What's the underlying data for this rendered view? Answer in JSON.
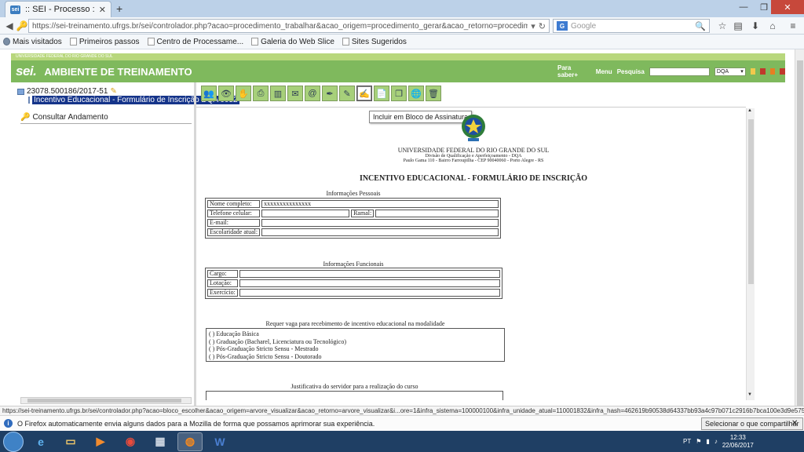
{
  "browser": {
    "tab_title": ":: SEI - Processo ::",
    "favicon_text": "sei",
    "new_tab": "+",
    "url": "https://sei-treinamento.ufrgs.br/sei/controlador.php?acao=procedimento_trabalhar&acao_origem=procedimento_gerar&acao_retorno=procedimento_escolher_tipo&id_procedimen",
    "search_placeholder": "Google",
    "search_engine": "G"
  },
  "bookmarks": [
    "Mais visitados",
    "Primeiros passos",
    "Centro de Processame...",
    "Galeria do Web Slice",
    "Sites Sugeridos"
  ],
  "sei": {
    "university": "UNIVERSIDADE FEDERAL DO RIO GRANDE DO SUL",
    "logo": "sei.",
    "environment": "AMBIENTE DE TREINAMENTO",
    "links": [
      "Para saber+",
      "Menu",
      "Pesquisa"
    ],
    "unit": "DQA",
    "header_color": "#7fb95d"
  },
  "tree": {
    "process": "23078.500186/2017-51",
    "document": "Incentivo Educacional - Formulário de Inscrição DQA 0052",
    "consult": "Consultar Andamento"
  },
  "toolbar": {
    "tooltip": "Incluir em Bloco de Assinatura",
    "icons": [
      "people-icon",
      "eye-icon",
      "hand-icon",
      "printer-icon",
      "books-icon",
      "scroll-icon",
      "mail-icon",
      "pen-icon",
      "edit-icon",
      "signature-icon",
      "new-doc-icon",
      "copy-icon",
      "globe-icon",
      "trash-icon"
    ],
    "active_index": 10
  },
  "document": {
    "institution": "UNIVERSIDADE FEDERAL DO RIO GRANDE DO SUL",
    "division": "Divisão de Qualificação e Aperfeiçoamento - DQA",
    "address": "Paulo Gama 110 - Bairro Farroupilha - CEP 90040060 - Porto Alegre - RS",
    "title": "INCENTIVO EDUCACIONAL - FORMULÁRIO DE INSCRIÇÃO",
    "personal": {
      "heading": "Informações Pessoais",
      "nome_label": "Nome completo:",
      "nome_value": "xxxxxxxxxxxxxxx",
      "telefone_label": "Telefone celular:",
      "ramal_label": "Ramal:",
      "email_label": "E-mail:",
      "escolaridade_label": "Escolaridade atual:"
    },
    "functional": {
      "heading": "Informações Funcionais",
      "cargo_label": "Cargo:",
      "lotacao_label": "Lotação:",
      "exercicio_label": "Exercício:"
    },
    "modalidade": {
      "heading": "Requer vaga para recebimento de incentivo educacional na modalidade",
      "options": [
        "(   ) Educação Básica",
        "(   ) Graduação (Bacharel, Licenciatura ou Tecnológico)",
        "(   ) Pós-Graduação Stricto Sensu - Mestrado",
        "(   ) Pós-Graduação Stricto Sensu - Doutorado"
      ]
    },
    "justificativa_heading": "Justificativa do servidor para a realização do curso"
  },
  "status_url": "https://sei-treinamento.ufrgs.br/sei/controlador.php?acao=bloco_escolher&acao_origem=arvore_visualizar&acao_retorno=arvore_visualizar&i...ore=1&infra_sistema=100000100&infra_unidade_atual=110001832&infra_hash=462619b90538d64337bb93a4c97b071c2916b7bca100e3d9e57528179a4bac71",
  "notification": {
    "text": "O Firefox automaticamente envia alguns dados para a Mozilla de forma que possamos aprimorar sua experiência.",
    "button": "Selecionar o que compartilhar"
  },
  "taskbar": {
    "lang": "PT",
    "time": "12:33",
    "date": "22/06/2017"
  }
}
